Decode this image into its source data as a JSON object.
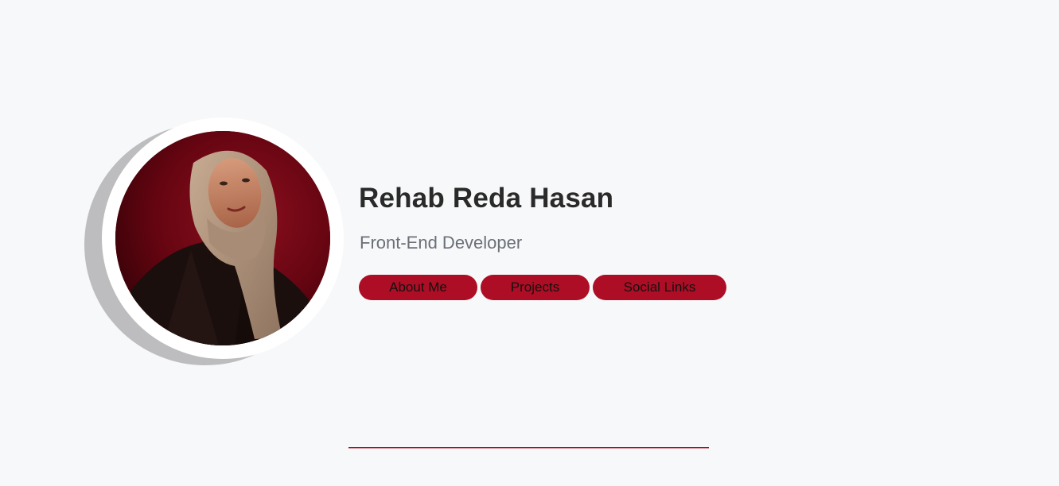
{
  "profile": {
    "name": "Rehab Reda Hasan",
    "role": "Front-End Developer"
  },
  "actions": [
    {
      "label": "About Me"
    },
    {
      "label": "Projects"
    },
    {
      "label": "Social Links"
    }
  ],
  "colors": {
    "accent": "#ad0e25",
    "background": "#f7f8fa",
    "name_text": "#2a2a2a",
    "role_text": "#6b6f76"
  }
}
